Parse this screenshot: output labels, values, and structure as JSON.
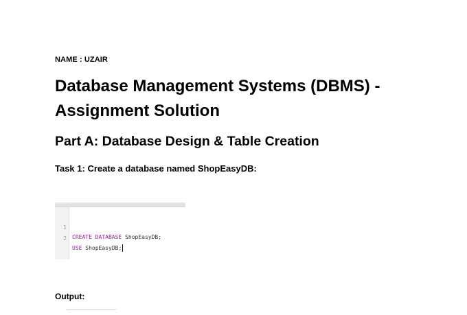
{
  "document": {
    "name_line": "NAME : UZAIR",
    "title": "Database Management Systems (DBMS) - Assignment Solution",
    "part_heading": "Part A: Database Design & Table Creation",
    "task_heading": "Task 1: Create a database named ShopEasyDB:",
    "output_label": "Output:"
  },
  "code_block": {
    "lines": [
      {
        "number": "1",
        "keywords": "CREATE DATABASE",
        "identifier": "ShopEasyDB",
        "terminator": ";"
      },
      {
        "number": "2",
        "keywords": "USE",
        "identifier": "ShopEasyDB",
        "terminator": ";"
      }
    ],
    "colors": {
      "keyword": "#8b2a8b",
      "line_number": "#9a9a9a"
    }
  }
}
